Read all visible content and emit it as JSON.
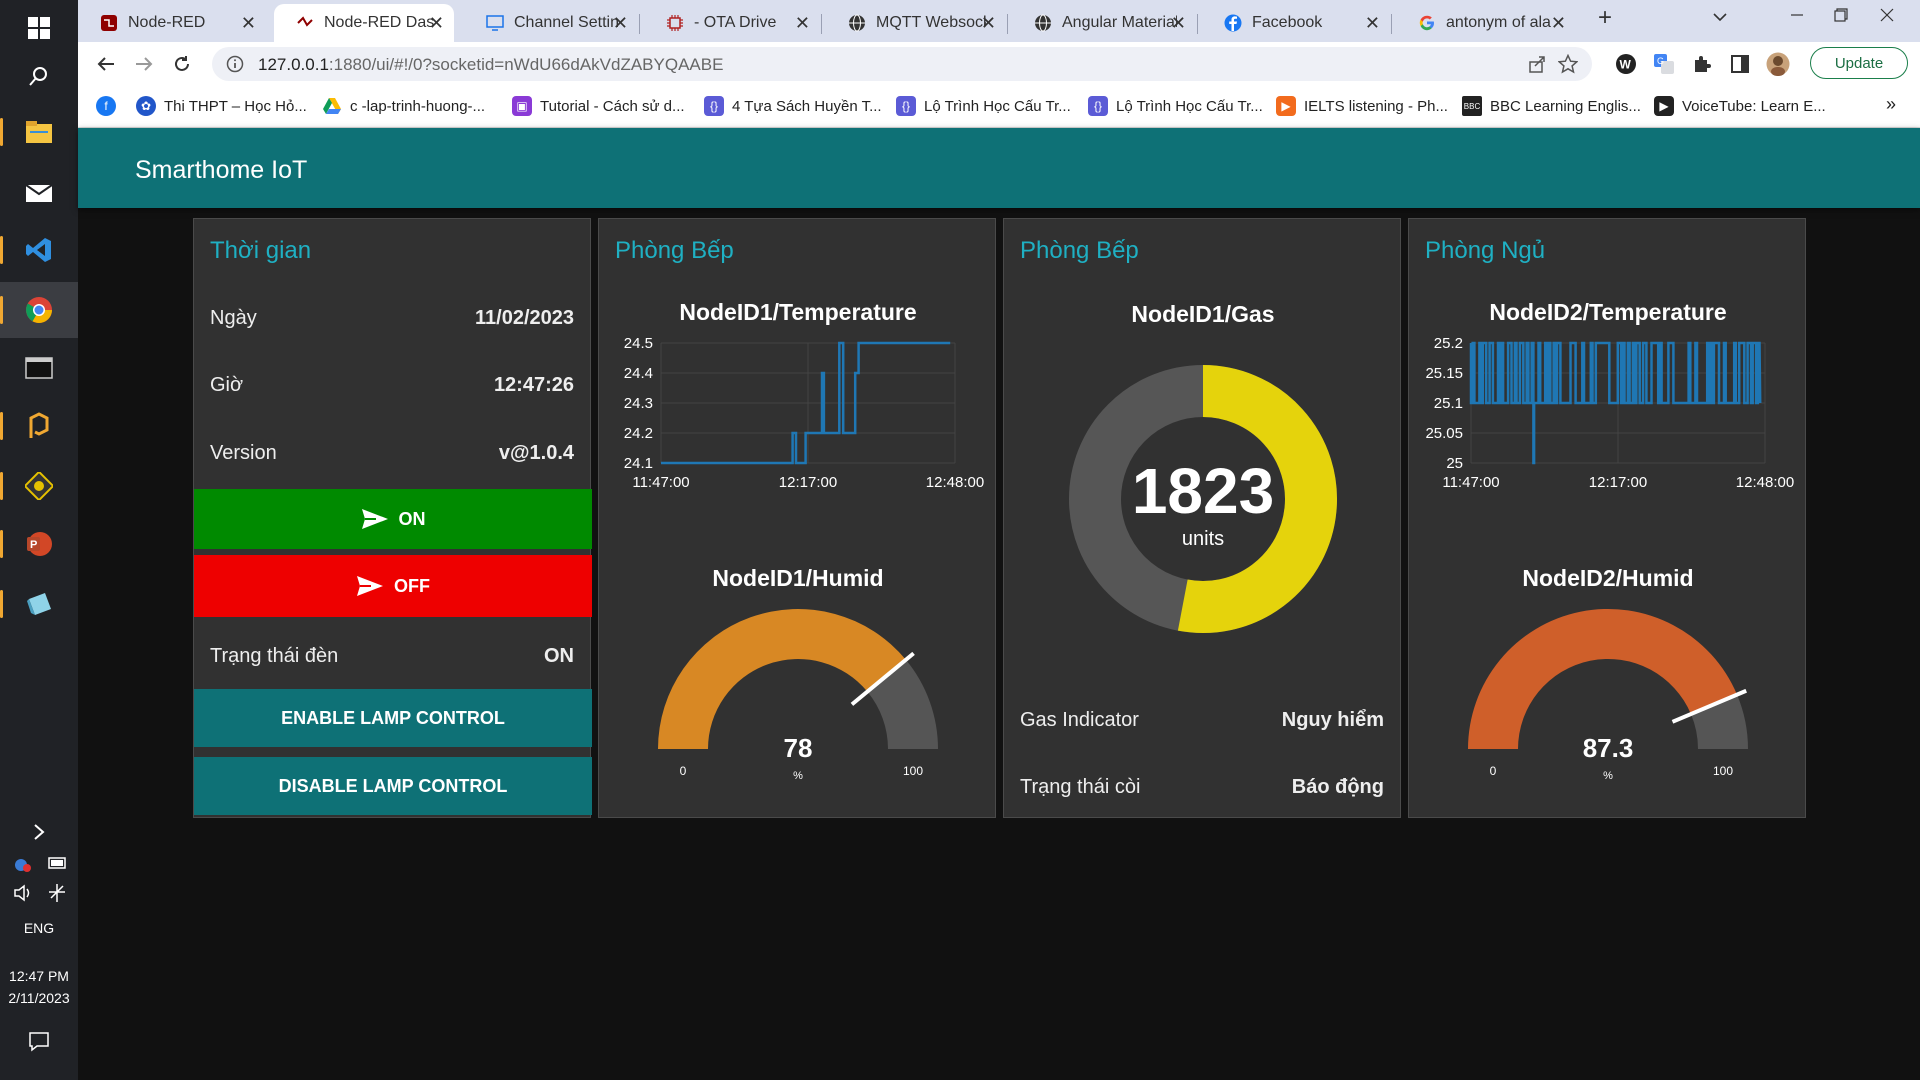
{
  "browser": {
    "tabs": [
      {
        "title": "Node-RED",
        "icon": "node-red-icon"
      },
      {
        "title": "Node-RED Dashboard",
        "icon": "node-red-dashboard-icon"
      },
      {
        "title": "Channel Settings",
        "icon": "monitor-icon"
      },
      {
        "title": "- OTA Drive",
        "icon": "chip-icon"
      },
      {
        "title": "MQTT Websocket",
        "icon": "globe-icon"
      },
      {
        "title": "Angular Material",
        "icon": "globe-icon"
      },
      {
        "title": "Facebook",
        "icon": "facebook-icon"
      },
      {
        "title": "antonym of alarm",
        "icon": "google-icon"
      }
    ],
    "url_host": "127.0.0.1",
    "url_rest": ":1880/ui/#!/0?socketid=nWdU66dAkVdZABYQAABE",
    "update_label": "Update",
    "bookmarks": [
      "Thi THPT – Học Hỏ...",
      "c -lap-trinh-huong-...",
      "Tutorial - Cách sử d...",
      "4 Tựa Sách Huyền T...",
      "Lộ Trình Học Cấu Tr...",
      "Lộ Trình Học Cấu Tr...",
      "IELTS listening - Ph...",
      "BBC Learning Englis...",
      "VoiceTube: Learn E..."
    ]
  },
  "taskbar": {
    "lang": "ENG",
    "time": "12:47 PM",
    "date": "2/11/2023"
  },
  "dashboard": {
    "title": "Smarthome IoT",
    "colors": {
      "header": "#0e7176",
      "accent": "#1fb0c3",
      "on": "#008a00",
      "off": "#ee0000"
    },
    "time_group": {
      "title": "Thời gian",
      "date_label": "Ngày",
      "date_value": "11/02/2023",
      "time_label": "Giờ",
      "time_value": "12:47:26",
      "version_label": "Version",
      "version_value": "v@1.0.4",
      "on_label": "ON",
      "off_label": "OFF",
      "lamp_label": "Trạng thái đèn",
      "lamp_value": "ON",
      "enable_label": "ENABLE LAMP CONTROL",
      "disable_label": "DISABLE LAMP CONTROL"
    },
    "kitchen": {
      "title": "Phòng Bếp",
      "temp_title": "NodeID1/Temperature",
      "humid_title": "NodeID1/Humid"
    },
    "kitchen_gas": {
      "title": "Phòng Bếp",
      "gas_title": "NodeID1/Gas",
      "gas_indicator_label": "Gas Indicator",
      "gas_indicator_value": "Nguy hiểm",
      "horn_label": "Trạng thái còi",
      "horn_value": "Báo động"
    },
    "bedroom": {
      "title": "Phòng Ngủ",
      "temp_title": "NodeID2/Temperature",
      "humid_title": "NodeID2/Humid"
    }
  },
  "chart_data": [
    {
      "type": "line",
      "title": "NodeID1/Temperature",
      "x_ticks": [
        "11:47:00",
        "12:17:00",
        "12:48:00"
      ],
      "y_ticks": [
        "24.1",
        "24.2",
        "24.3",
        "24.4",
        "24.5"
      ],
      "ylim": [
        24.1,
        24.5
      ],
      "xlim_minutes": [
        0,
        61
      ],
      "x": [
        0,
        27,
        27.3,
        27.6,
        28,
        29.5,
        30,
        33,
        33.4,
        33.8,
        34,
        34.5,
        37,
        37.4,
        37.8,
        38,
        38.5,
        40,
        40.3,
        40.6,
        41,
        60
      ],
      "y": [
        24.1,
        24.1,
        24.2,
        24.2,
        24.1,
        24.1,
        24.2,
        24.2,
        24.4,
        24.2,
        24.2,
        24.2,
        24.5,
        24.5,
        24.2,
        24.2,
        24.2,
        24.2,
        24.4,
        24.4,
        24.5,
        24.5
      ],
      "color": "#1f77b4"
    },
    {
      "type": "gauge",
      "title": "NodeID1/Humid",
      "value": 78,
      "min": 0,
      "max": 100,
      "unit": "%",
      "min_label": "0",
      "max_label": "100",
      "value_label": "78",
      "color": "#d88824"
    },
    {
      "type": "donut",
      "title": "NodeID1/Gas",
      "value": 1823,
      "value_label": "1823",
      "unit": "units",
      "fraction": 0.53,
      "color": "#e5d30c"
    },
    {
      "type": "line",
      "title": "NodeID2/Temperature",
      "x_ticks": [
        "11:47:00",
        "12:17:00",
        "12:48:00"
      ],
      "y_ticks": [
        "25",
        "25.05",
        "25.1",
        "25.15",
        "25.2"
      ],
      "ylim": [
        25.0,
        25.2
      ],
      "xlim_minutes": [
        0,
        61
      ],
      "segments": "oscillating between 25.1 and 25.2 from 0 to 60 minutes, single dip to 25.0 near minute 13",
      "color": "#1f77b4"
    },
    {
      "type": "gauge",
      "title": "NodeID2/Humid",
      "value": 87.3,
      "min": 0,
      "max": 100,
      "unit": "%",
      "min_label": "0",
      "max_label": "100",
      "value_label": "87.3",
      "color": "#cf5f2a"
    }
  ]
}
